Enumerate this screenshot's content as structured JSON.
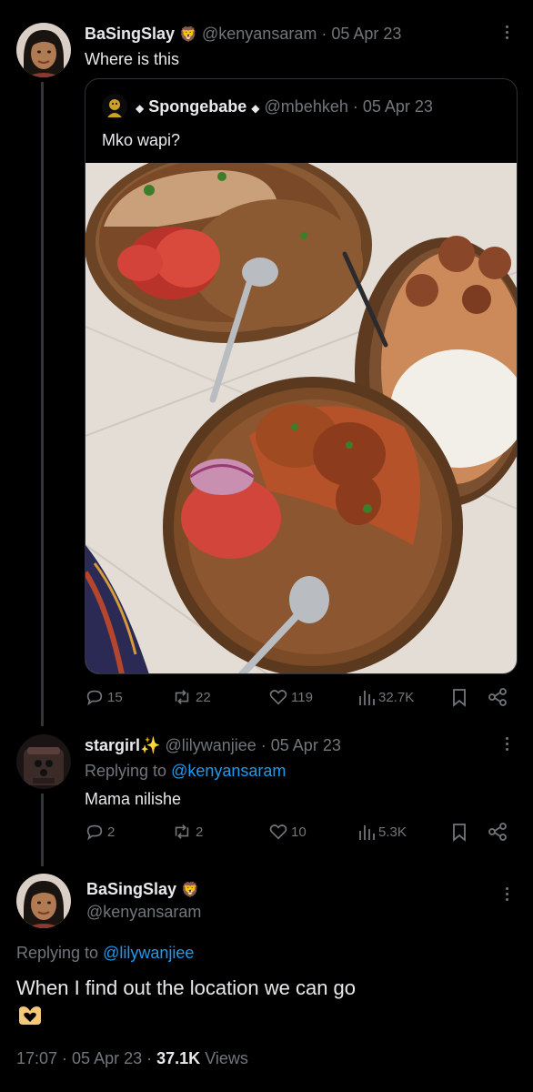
{
  "tweet1": {
    "display_name": "BaSingSlay",
    "badge_emoji": "🦁",
    "handle": "@kenyansaram",
    "date": "· 05 Apr 23",
    "text": "Where is this",
    "quote": {
      "display_name": "Spongebabe",
      "handle": "@mbehkeh",
      "date": "· 05 Apr 23",
      "text": "Mko wapi?"
    },
    "stats": {
      "replies": "15",
      "reposts": "22",
      "likes": "119",
      "views": "32.7K"
    }
  },
  "tweet2": {
    "display_name": "stargirl✨",
    "handle": "@lilywanjiee",
    "date": "· 05 Apr 23",
    "replying_prefix": "Replying to",
    "replying_handle": "@kenyansaram",
    "text": "Mama nilishe",
    "stats": {
      "replies": "2",
      "reposts": "2",
      "likes": "10",
      "views": "5.3K"
    }
  },
  "main": {
    "display_name": "BaSingSlay",
    "badge_emoji": "🦁",
    "handle": "@kenyansaram",
    "replying_prefix": "Replying to",
    "replying_handle": "@lilywanjiee",
    "text": "When I find out the location we can go",
    "meta_time": "17:07 · 05 Apr 23 ·",
    "meta_views_count": "37.1K",
    "meta_views_label": "Views"
  },
  "colors": {
    "accent": "#1d9bf0",
    "muted": "#71767b",
    "background": "#000000"
  }
}
